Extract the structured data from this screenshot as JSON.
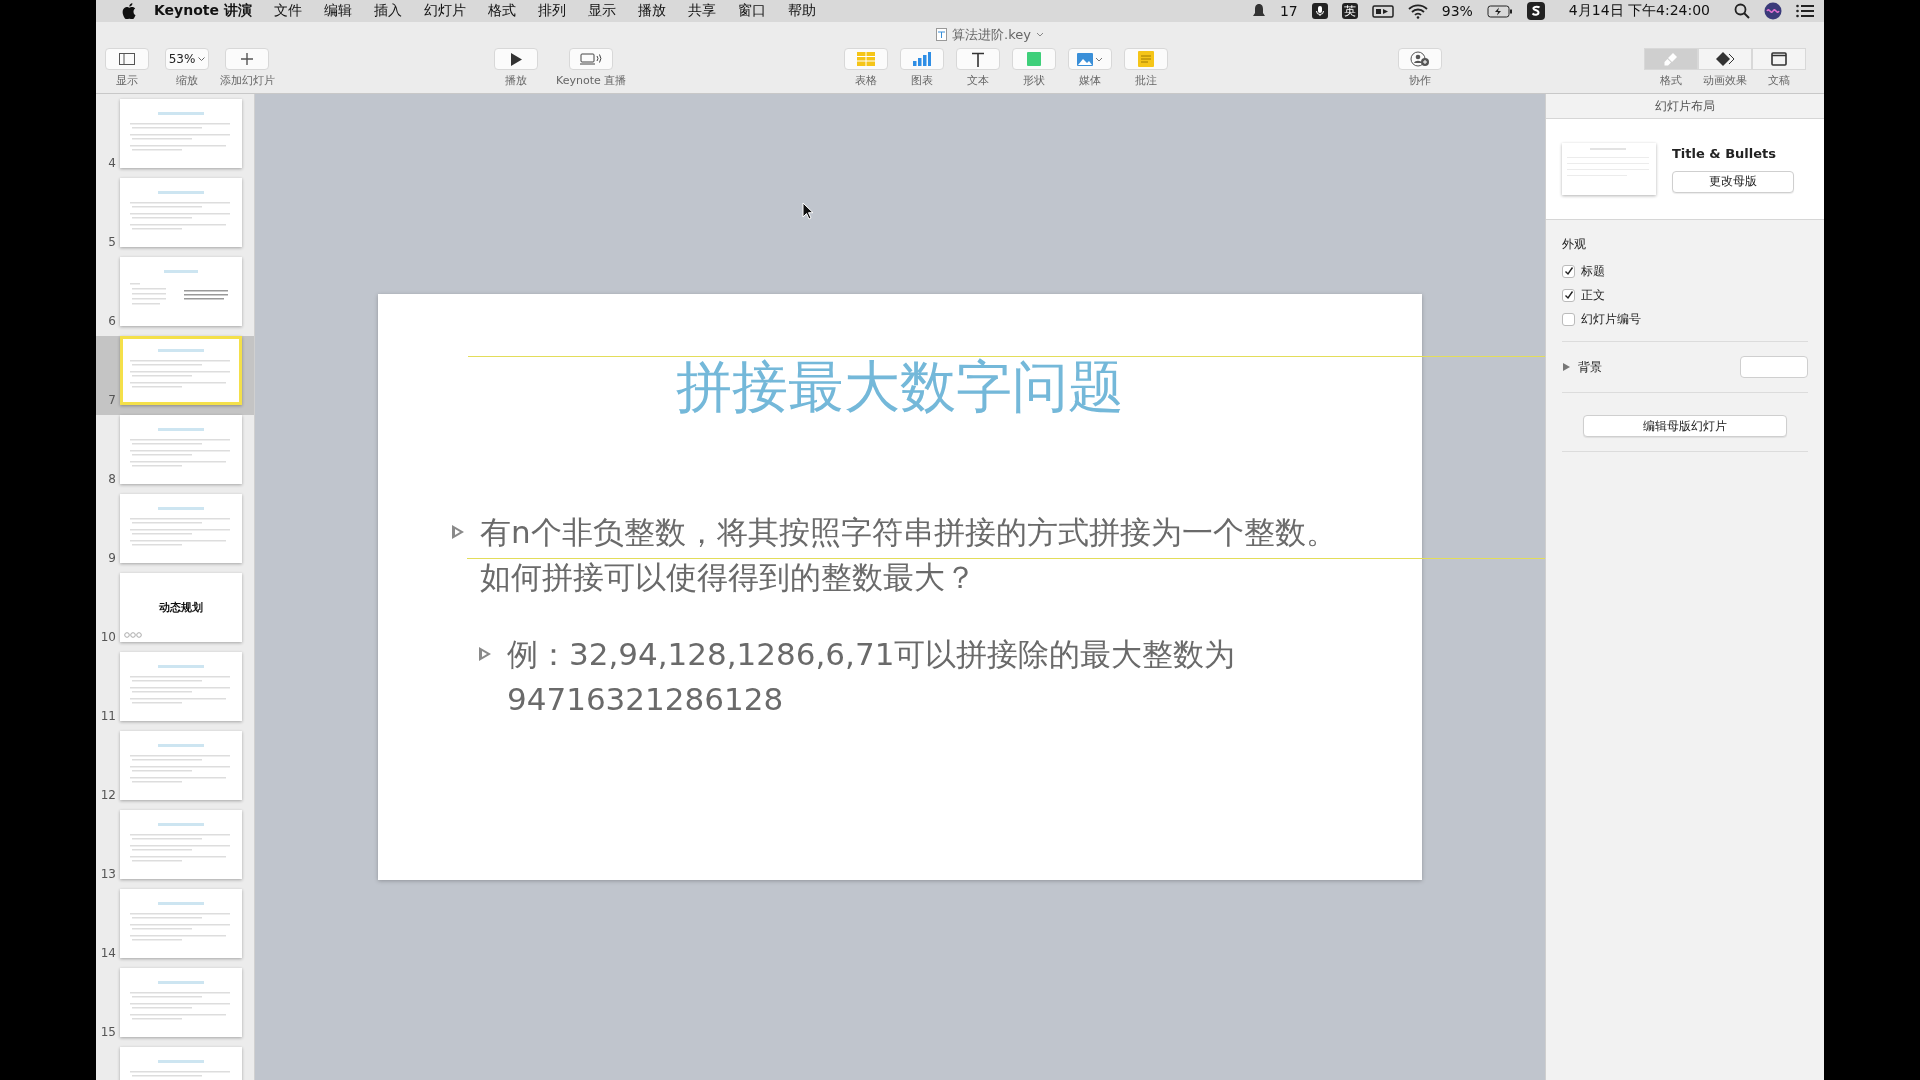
{
  "menu_bar": {
    "app": "Keynote 讲演",
    "menus": [
      "文件",
      "编辑",
      "插入",
      "幻灯片",
      "格式",
      "排列",
      "显示",
      "播放",
      "共享",
      "窗口",
      "帮助"
    ],
    "status": {
      "notifications": "17",
      "input_method": "英",
      "battery": "93%",
      "clock": "4月14日 下午4:24:00"
    }
  },
  "window": {
    "title": "算法进阶.key"
  },
  "toolbar": {
    "groups": [
      [
        {
          "kind": "view",
          "label": "显示"
        },
        {
          "kind": "zoom",
          "label": "缩放",
          "value": "53%"
        },
        {
          "kind": "add",
          "label": "添加幻灯片"
        }
      ],
      [
        {
          "kind": "play",
          "label": "播放"
        },
        {
          "kind": "live",
          "label": "Keynote 直播"
        }
      ],
      [
        {
          "kind": "table",
          "label": "表格"
        },
        {
          "kind": "chart",
          "label": "图表"
        },
        {
          "kind": "text",
          "label": "文本"
        },
        {
          "kind": "shape",
          "label": "形状"
        },
        {
          "kind": "media",
          "label": "媒体"
        },
        {
          "kind": "comment",
          "label": "批注"
        }
      ],
      [
        {
          "kind": "collab",
          "label": "协作"
        }
      ]
    ],
    "inspector_tabs": [
      {
        "kind": "format",
        "label": "格式",
        "selected": true
      },
      {
        "kind": "animate",
        "label": "动画效果",
        "selected": false
      },
      {
        "kind": "document",
        "label": "文稿",
        "selected": false
      }
    ]
  },
  "slides": [
    {
      "number": "4",
      "kind": "bullets",
      "selected": false
    },
    {
      "number": "5",
      "kind": "bullets",
      "selected": false
    },
    {
      "number": "6",
      "kind": "columns",
      "selected": false
    },
    {
      "number": "7",
      "kind": "bullets",
      "selected": true
    },
    {
      "number": "8",
      "kind": "bullets",
      "selected": false
    },
    {
      "number": "9",
      "kind": "bullets",
      "selected": false
    },
    {
      "number": "10",
      "kind": "section",
      "title": "动态规划",
      "selected": false
    },
    {
      "number": "11",
      "kind": "bullets",
      "selected": false
    },
    {
      "number": "12",
      "kind": "bullets",
      "selected": false
    },
    {
      "number": "13",
      "kind": "bullets",
      "selected": false
    },
    {
      "number": "14",
      "kind": "bullets",
      "selected": false
    },
    {
      "number": "15",
      "kind": "bullets",
      "selected": false
    },
    {
      "kind": "bullets",
      "selected": false
    }
  ],
  "slide": {
    "title": "拼接最大数字问题",
    "bullets": [
      {
        "text": "有n个非负整数，将其按照字符串拼接的方式拼接为一个整数。如何拼接可以使得得到的整数最大？",
        "children": [
          {
            "text": "例：32,94,128,1286,6,71可以拼接除的最大整数为94716321286128"
          }
        ]
      }
    ]
  },
  "inspector": {
    "header": "幻灯片布局",
    "layout_name": "Title & Bullets",
    "change_master": "更改母版",
    "appearance_title": "外观",
    "appearance": [
      {
        "label": "标题",
        "checked": true
      },
      {
        "label": "正文",
        "checked": true
      },
      {
        "label": "幻灯片编号",
        "checked": false
      }
    ],
    "background": {
      "label": "背景",
      "expanded": false
    },
    "edit_master": "编辑母版幻灯片"
  }
}
